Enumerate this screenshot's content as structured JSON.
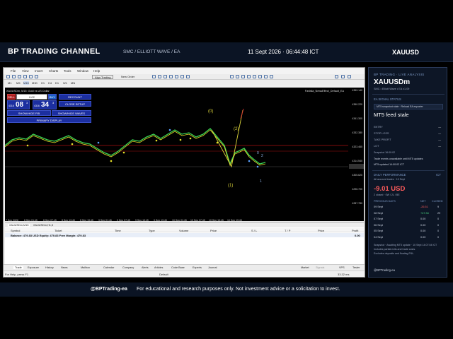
{
  "banner": {
    "channel": "BP TRADING CHANNEL",
    "subtitle": "SMC / ELLIOTT WAVE / EA",
    "datetime": "11 Sept 2026 · 06:44:48 ICT",
    "symbol": "XAUUSD"
  },
  "mt5": {
    "menu": [
      "File",
      "View",
      "Insert",
      "Charts",
      "Tools",
      "Window",
      "Help"
    ],
    "toolbar": {
      "algo_trading": "Algo Trading",
      "new_order": "New Order"
    },
    "timeframes": [
      "M1",
      "M5",
      "M15",
      "M30",
      "H1",
      "H4",
      "D1",
      "W1",
      "MN"
    ],
    "chart": {
      "tab_label": "XAUUSDm, M15: Gold vs US Dollar",
      "top_right_label": "Farfalla_NewsEffect_Default_EA",
      "panel": {
        "sell_label": "SELL",
        "lot_value": "0.02",
        "buy_label": "BUY",
        "recount_label": "RECOUNT",
        "sell_price_prefix": "4316",
        "sell_price_big": "08",
        "sell_price_sup": "3",
        "buy_price_prefix": "4316",
        "buy_price_big": "34",
        "buy_price_sup": "3",
        "close_setup_label": "CLOSE SETUP",
        "show_hide_fib": "SHOW/HIDE FIB",
        "show_hide_waves": "SHOW/HIDE WAVES",
        "primary_display": "PRIMARY DISPLAY"
      },
      "wave_labels": [
        "(0)",
        "(2)",
        "(1)"
      ],
      "y_ticks": [
        "4359.140",
        "4350.220",
        "4341.300",
        "4332.380",
        "4323.460",
        "4314.540",
        "4305.620",
        "4296.700",
        "4287.780"
      ],
      "x_ticks": [
        "7 Sep 2026",
        "8 Sep 01:45",
        "8 Sep 07:45",
        "8 Sep 13:45",
        "8 Sep 19:45",
        "9 Sep 01:45",
        "9 Sep 07:45",
        "9 Sep 13:45",
        "9 Sep 19:45",
        "10 Sep 01:45",
        "10 Sep 07:45",
        "10 Sep 13:45",
        "10 Sep 19:45"
      ]
    },
    "toolbox": {
      "tabs": [
        "XAUUSDm,M15",
        "XAUUSDm,H1,5"
      ],
      "columns": [
        "Symbol",
        "Ticket",
        "Time",
        "Type",
        "Volume",
        "Price",
        "S / L",
        "T / P",
        "Price",
        "Profit"
      ],
      "balance_line": "Balance: 479.83 USD  Equity: 479.83  Free Margin: 479.83",
      "balance_profit": "0.00"
    },
    "bottom_tabs": [
      "Trade",
      "Exposure",
      "History",
      "News",
      "Mailbox",
      "Calendar",
      "Company",
      "Alerts",
      "Articles",
      "Code Base",
      "Experts",
      "Journal"
    ],
    "bottom_right": [
      "Market",
      "Signals",
      "VPS",
      "Tester"
    ],
    "status": {
      "help": "For Help, press F1",
      "profile": "Default",
      "ping": "33.32 ms"
    }
  },
  "ea": {
    "header": "BP TRADING · LIVE ANALYSIS",
    "symbol": "XAUUSDm",
    "symbol_sub": "SMC • Elliott Wave • EA v1.09",
    "signal_status_title": "EA SIGNAL STATUS",
    "snapshot_badge": "MT5 snapshot stale · Reload EA exporter",
    "feed_status": "MT5 feed stale",
    "rows": [
      {
        "label": "ENTRY",
        "value": "—"
      },
      {
        "label": "STOP LOSS",
        "value": "—"
      },
      {
        "label": "TAKE PROFIT",
        "value": "—"
      },
      {
        "label": "LOT",
        "value": "—"
      }
    ],
    "snapshot_time": "Snapshot 16:00:02",
    "trade_note": "Trade events unavailable until MT5 updates",
    "mt5_updated": "MT5 updated 14:00:02 ICT",
    "daily_title": "DAILY PERFORMANCE",
    "daily_tz": "ICT",
    "daily_sub": "All account trades · 10 Sept",
    "pnl": "-9.01 USD",
    "pnl_sub": "2 closed · 0W / 2L / BE",
    "table_headers": [
      "PREVIOUS DAYS",
      "NET",
      "CLOSED"
    ],
    "table_rows": [
      {
        "day": "09 Sept",
        "net": "-26.51",
        "closed": "9"
      },
      {
        "day": "08 Sept",
        "net": "+47.34",
        "closed": "29"
      },
      {
        "day": "07 Sept",
        "net": "0.00",
        "closed": "0"
      },
      {
        "day": "06 Sept",
        "net": "0.00",
        "closed": "0"
      },
      {
        "day": "05 Sept",
        "net": "0.00",
        "closed": "0"
      },
      {
        "day": "04 Sept",
        "net": "0.00",
        "closed": "0"
      }
    ],
    "footnote_1": "Snapshot · Awaiting MT5 update · 10 Sept 14:07:04 ICT",
    "footnote_2": "Includes partial exits and trade costs.",
    "footnote_3": "Excludes deposits and floating P&L.",
    "handle": "@BPTrading-ea",
    "colors": {
      "negative": "#ff5c5c",
      "positive": "#4cdf86"
    }
  },
  "footer": {
    "handle": "@BPTrading-ea",
    "disclaimer": "For educational and research purposes only. Not investment advice or a solicitation to invest."
  }
}
